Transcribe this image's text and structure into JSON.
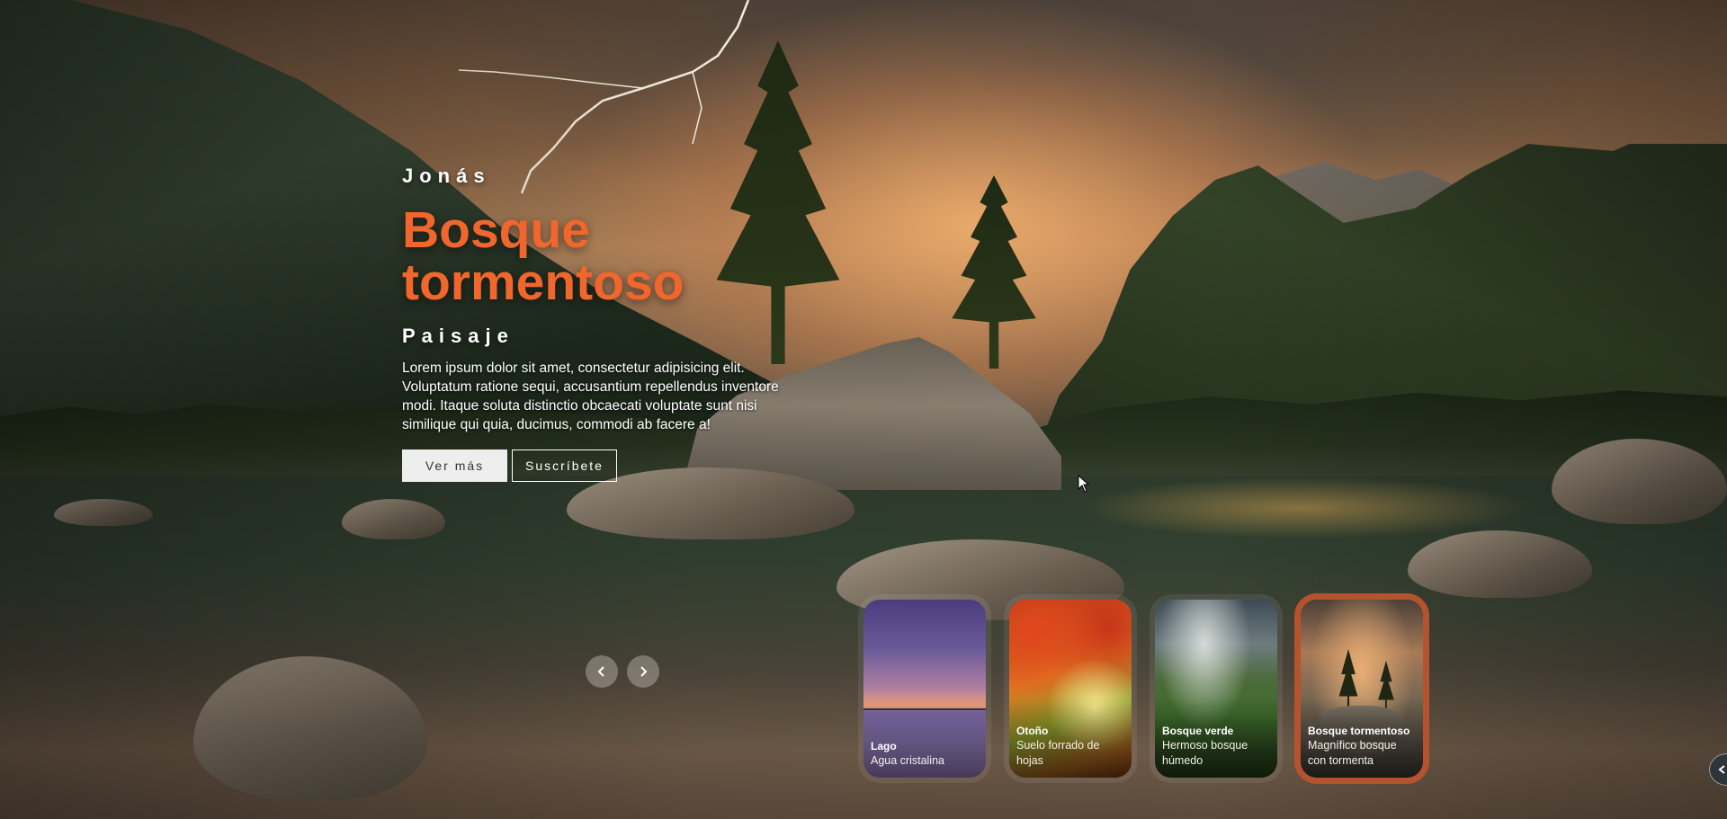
{
  "hero": {
    "author": "Jonás",
    "title": "Bosque tormentoso",
    "topic": "Paisaje",
    "description": "Lorem ipsum dolor sit amet, consectetur adipisicing elit. Voluptatum ratione sequi, accusantium repellendus inventore modi. Itaque soluta distinctio obcaecati voluptate sunt nisi similique qui quia, ducimus, commodi ab facere a!",
    "primary_button": "Ver más",
    "secondary_button": "Suscríbete",
    "accent_color": "#f0662d"
  },
  "navigation": {
    "prev_icon": "chevron-left-icon",
    "next_icon": "chevron-right-icon"
  },
  "thumbnails": [
    {
      "title": "Lago",
      "subtitle": "Agua cristalina",
      "active": false
    },
    {
      "title": "Otoño",
      "subtitle": "Suelo forrado de hojas",
      "active": false
    },
    {
      "title": "Bosque verde",
      "subtitle": "Hermoso bosque húmedo",
      "active": false
    },
    {
      "title": "Bosque tormentoso",
      "subtitle": "Magnífico bosque con tormenta",
      "active": true
    }
  ],
  "active_border_color": "#b4532e"
}
